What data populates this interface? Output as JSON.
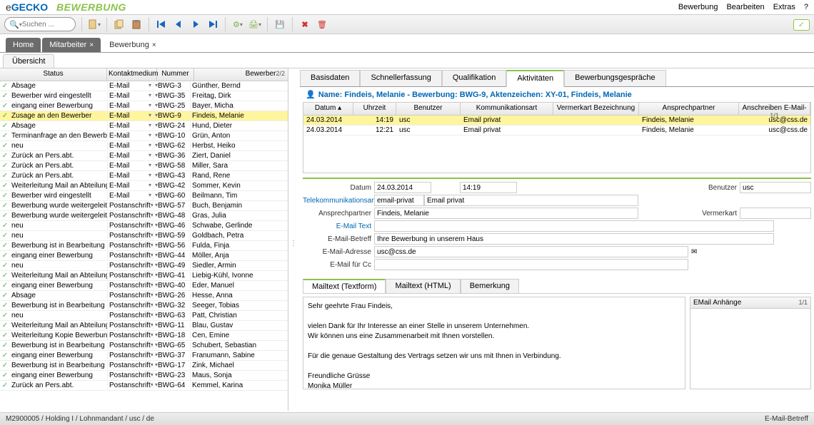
{
  "brand": {
    "prefix": "e",
    "name": "GECKO",
    "module": "BEWERBUNG"
  },
  "menu": [
    "Bewerbung",
    "Bearbeiten",
    "Extras",
    "?"
  ],
  "search_placeholder": "Suchen ...",
  "main_tabs": [
    {
      "label": "Home"
    },
    {
      "label": "Mitarbeiter",
      "close": true
    },
    {
      "label": "Bewerbung",
      "close": true
    }
  ],
  "subtab": "Übersicht",
  "left_headers": {
    "status": "Status",
    "medium": "Kontaktmedium",
    "nummer": "Nummer",
    "bewerber": "Bewerber",
    "count": "2/2"
  },
  "rows": [
    {
      "s": "Absage",
      "m": "E-Mail",
      "n": "BWG-3",
      "b": "Günther, Bernd"
    },
    {
      "s": "Bewerber wird eingestellt",
      "m": "E-Mail",
      "n": "BWG-35",
      "b": "Freitag, Dirk"
    },
    {
      "s": "eingang einer Bewerbung",
      "m": "E-Mail",
      "n": "BWG-25",
      "b": "Bayer, Micha"
    },
    {
      "s": "Zusage an den Bewerber",
      "m": "E-Mail",
      "n": "BWG-9",
      "b": "Findeis, Melanie",
      "sel": true
    },
    {
      "s": "Absage",
      "m": "E-Mail",
      "n": "BWG-24",
      "b": "Hund, Dieter"
    },
    {
      "s": "Terminanfrage an den Bewerber",
      "m": "E-Mail",
      "n": "BWG-10",
      "b": "Grün, Anton"
    },
    {
      "s": "neu",
      "m": "E-Mail",
      "n": "BWG-62",
      "b": "Herbst, Heiko"
    },
    {
      "s": "Zurück an Pers.abt.",
      "m": "E-Mail",
      "n": "BWG-36",
      "b": "Ziert, Daniel"
    },
    {
      "s": "Zurück an Pers.abt.",
      "m": "E-Mail",
      "n": "BWG-58",
      "b": "Miller, Sara"
    },
    {
      "s": "Zurück an Pers.abt.",
      "m": "E-Mail",
      "n": "BWG-43",
      "b": "Rand, Rene"
    },
    {
      "s": "Weiterleitung Mail an Abteilung X",
      "m": "E-Mail",
      "n": "BWG-42",
      "b": "Sommer, Kevin"
    },
    {
      "s": "Bewerber wird eingestellt",
      "m": "E-Mail",
      "n": "BWG-60",
      "b": "Beilmann, Tim"
    },
    {
      "s": "Bewerbung wurde weitergeleitet",
      "m": "Postanschrift",
      "n": "BWG-57",
      "b": "Buch, Benjamin"
    },
    {
      "s": "Bewerbung wurde weitergeleitet",
      "m": "Postanschrift",
      "n": "BWG-48",
      "b": "Gras, Julia"
    },
    {
      "s": "neu",
      "m": "Postanschrift",
      "n": "BWG-46",
      "b": "Schwabe, Gerlinde"
    },
    {
      "s": "neu",
      "m": "Postanschrift",
      "n": "BWG-59",
      "b": "Goldbach, Petra"
    },
    {
      "s": "Bewerbung ist in Bearbeitung",
      "m": "Postanschrift",
      "n": "BWG-56",
      "b": "Fulda, Finja"
    },
    {
      "s": "eingang einer Bewerbung",
      "m": "Postanschrift",
      "n": "BWG-44",
      "b": "Möller, Anja"
    },
    {
      "s": "neu",
      "m": "Postanschrift",
      "n": "BWG-49",
      "b": "Siedler, Armin"
    },
    {
      "s": "Weiterleitung Mail an Abteilung Y",
      "m": "Postanschrift",
      "n": "BWG-41",
      "b": "Liebig-Kühl, Ivonne"
    },
    {
      "s": "eingang einer Bewerbung",
      "m": "Postanschrift",
      "n": "BWG-40",
      "b": "Eder, Manuel"
    },
    {
      "s": "Absage",
      "m": "Postanschrift",
      "n": "BWG-26",
      "b": "Hesse, Anna"
    },
    {
      "s": "Bewerbung ist in Bearbeitung",
      "m": "Postanschrift",
      "n": "BWG-32",
      "b": "Seeger, Tobias"
    },
    {
      "s": "neu",
      "m": "Postanschrift",
      "n": "BWG-63",
      "b": "Patt, Christian"
    },
    {
      "s": "Weiterleitung Mail an Abteilung X",
      "m": "Postanschrift",
      "n": "BWG-11",
      "b": "Blau, Gustav"
    },
    {
      "s": "Weiterleitung Kopie Bewerbung...",
      "m": "Postanschrift",
      "n": "BWG-18",
      "b": "Cen, Emine"
    },
    {
      "s": "Bewerbung ist in Bearbeitung",
      "m": "Postanschrift",
      "n": "BWG-65",
      "b": "Schubert, Sebastian"
    },
    {
      "s": "eingang einer Bewerbung",
      "m": "Postanschrift",
      "n": "BWG-37",
      "b": "Franumann, Sabine"
    },
    {
      "s": "Bewerbung ist in Bearbeitung",
      "m": "Postanschrift",
      "n": "BWG-17",
      "b": "Zink, Michael"
    },
    {
      "s": "eingang einer Bewerbung",
      "m": "Postanschrift",
      "n": "BWG-23",
      "b": "Maus, Sonja"
    },
    {
      "s": "Zurück an Pers.abt.",
      "m": "Postanschrift",
      "n": "BWG-64",
      "b": "Kemmel, Karina"
    }
  ],
  "detail_tabs": [
    "Basisdaten",
    "Schnellerfassung",
    "Qualifikation",
    "Aktivitäten",
    "Bewerbungsgespräche"
  ],
  "detail_active": 3,
  "name_line": "Name: Findeis, Melanie - Bewerbung: BWG-9, Aktenzeichen: XY-01, Findeis, Melanie",
  "act_headers": {
    "datum": "Datum",
    "uhr": "Uhrzeit",
    "ben": "Benutzer",
    "komm": "Kommunikationsart",
    "verm": "Vermerkart Bezeichnung",
    "ansp": "Ansprechpartner",
    "anschr": "Anschreiben E-Mail-",
    "count": "1/1"
  },
  "activities": [
    {
      "d": "24.03.2014",
      "u": "14:19",
      "ben": "usc",
      "k": "Email privat",
      "v": "",
      "a": "Findeis, Melanie",
      "an": "usc@css.de",
      "sel": true
    },
    {
      "d": "24.03.2014",
      "u": "12:21",
      "ben": "usc",
      "k": "Email privat",
      "v": "",
      "a": "Findeis, Melanie",
      "an": "usc@css.de"
    }
  ],
  "form": {
    "datum_label": "Datum",
    "datum": "24.03.2014",
    "zeit": "14:19",
    "benutzer_label": "Benutzer",
    "benutzer": "usc",
    "telekomm_label": "Telekommunikationsart",
    "telekomm_val": "email-privat",
    "telekomm_desc": "Email privat",
    "ansprech_label": "Ansprechpartner",
    "ansprech": "Findeis, Melanie",
    "vermerk_label": "Vermerkart",
    "vermerk": "",
    "emailtext_label": "E-Mail Text",
    "emailtext": "",
    "betreff_label": "E-Mail-Betreff",
    "betreff": "Ihre Bewerbung in unserem Haus",
    "adresse_label": "E-Mail-Adresse",
    "adresse": "usc@css.de",
    "cc_label": "E-Mail für Cc"
  },
  "sub_tabs": [
    "Mailtext (Textform)",
    "Mailtext (HTML)",
    "Bemerkung"
  ],
  "mail_body": "Sehr geehrte Frau Findeis,\n\nvielen Dank für Ihr Interesse an einer Stelle in unserem Unternehmen.\nWir können uns eine Zusammenarbeit mit Ihnen vorstellen.\n\nFür die genaue Gestaltung des Vertrags setzen wir uns mit Ihnen in Verbindung.\n\nFreundliche Grüsse\nMonika Müller\nPersonalwesen",
  "attach_header": "EMail Anhänge",
  "attach_count": "1/1",
  "status_left": "M2900005 / Holding I / Lohnmandant / usc / de",
  "status_right": "E-Mail-Betreff"
}
